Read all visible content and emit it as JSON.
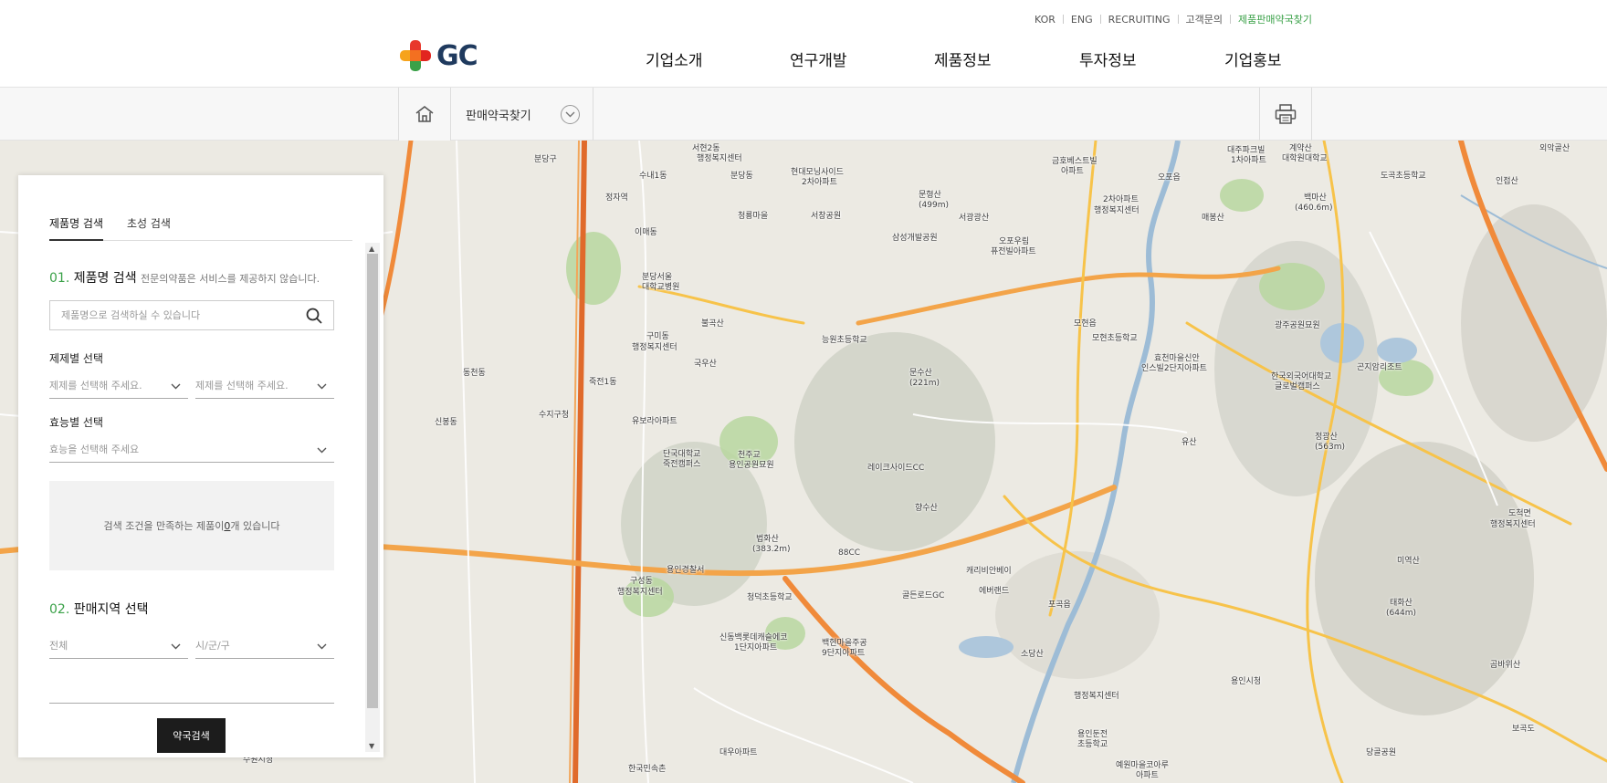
{
  "header": {
    "util_links": [
      "KOR",
      "ENG",
      "RECRUITING",
      "고객문의",
      "제품판매약국찾기"
    ],
    "logo_text": "GC",
    "gnb": [
      "기업소개",
      "연구개발",
      "제품정보",
      "투자정보",
      "기업홍보"
    ]
  },
  "subnav": {
    "current": "판매약국찾기"
  },
  "panel": {
    "tabs": [
      "제품명 검색",
      "초성 검색"
    ],
    "section1": {
      "num": "01.",
      "title": "제품명 검색",
      "desc": "전문의약품은 서비스를 제공하지 않습니다."
    },
    "search": {
      "placeholder": "제품명으로 검색하실 수 있습니다"
    },
    "dosage_form": {
      "label": "제제별 선택",
      "select1": "제제를 선택해 주세요.",
      "select2": "제제를 선택해 주세요."
    },
    "efficacy": {
      "label": "효능별 선택",
      "select": "효능을 선택해 주세요"
    },
    "result": {
      "before": "검색 조건을 만족하는 제품이 ",
      "count": "0",
      "after": "개 있습니다"
    },
    "section2": {
      "num": "02.",
      "title": "판매지역 선택"
    },
    "region": {
      "select1": "전체",
      "select2": "시/군/구"
    },
    "search_button": "약국검색"
  },
  "map": {
    "labels": [
      "분당구",
      "서현2동",
      "행정복지센터",
      "수내1동",
      "분당동",
      "현대모닝사이드",
      "2차아파트",
      "청룡마을",
      "서창공원",
      "정자역",
      "이매동",
      "금호베스트빌",
      "아파트",
      "오포읍",
      "대주파크빌",
      "1차아파트",
      "계약산",
      "대학원대학교",
      "외악골산",
      "분당서울",
      "대학교병원",
      "구미동",
      "행정복지센터",
      "불곡산",
      "국우산",
      "문형산",
      "(499m)",
      "삼성개발공원",
      "서광광산",
      "오포우림",
      "퓨전빌아파트",
      "2차아파트",
      "행정복지센터",
      "매봉산",
      "백마산",
      "(460.6m)",
      "도곡초등학교",
      "인접산",
      "수지구청",
      "신봉동",
      "동천동",
      "죽전1동",
      "유보라아파트",
      "단국대학교",
      "죽전캠퍼스",
      "천주교",
      "용인공원묘원",
      "레이크사이드CC",
      "능원초등학교",
      "문수산",
      "(221m)",
      "모현읍",
      "모현초등학교",
      "효천마을신안",
      "인스빌2단지아파트",
      "한국외국어대학교",
      "글로벌캠퍼스",
      "광주공원묘원",
      "곤지암리조트",
      "정광산",
      "(563m)",
      "구성동",
      "행정복지센터",
      "법화산",
      "(383.2m)",
      "88CC",
      "향수산",
      "캐리비안베이",
      "에버랜드",
      "백현마을주공",
      "9단지아파트",
      "포곡읍",
      "행정복지센터",
      "용인시청",
      "유산",
      "도척면",
      "행정복지센터",
      "태화산",
      "(644m)",
      "미역산",
      "수원시청",
      "한국민속촌",
      "신동백롯데캐슬에코",
      "1단지아파트",
      "대우아파트",
      "용인경찰서",
      "청덕초등학교",
      "골든로드GC",
      "소당산",
      "용인둔전",
      "초등학교",
      "예원마을코아루",
      "아파트",
      "당골공원",
      "곰바위산",
      "보곡도"
    ]
  }
}
